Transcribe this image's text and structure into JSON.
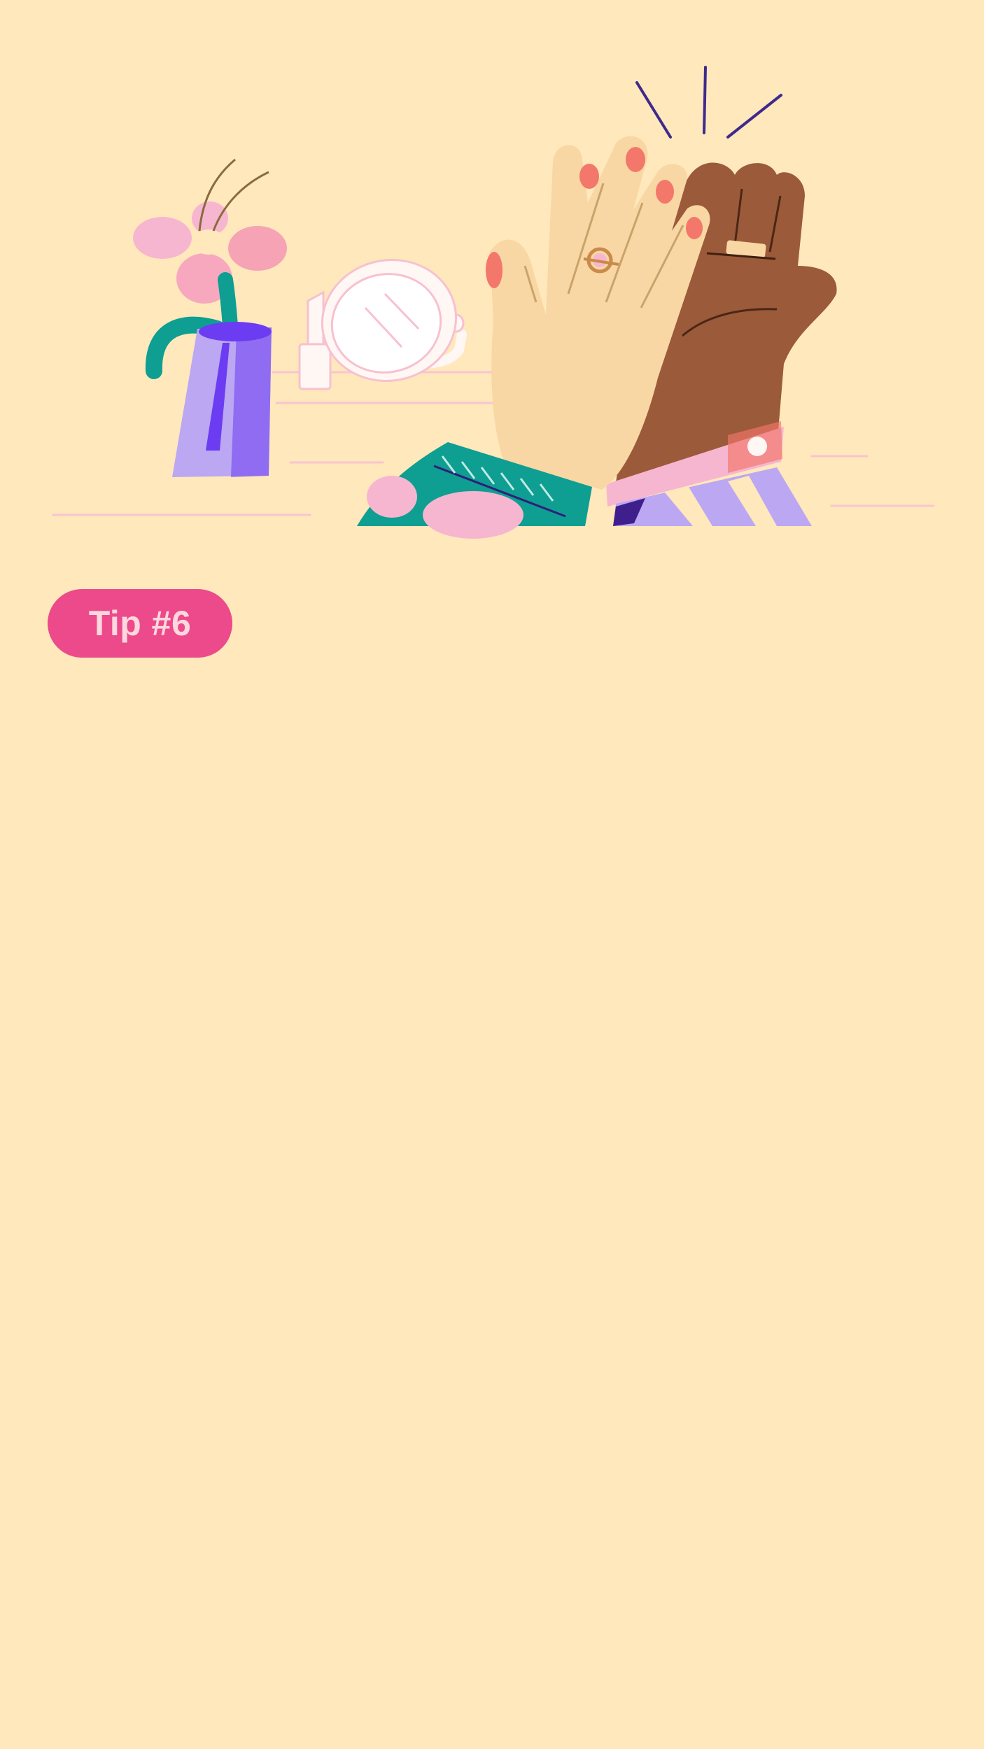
{
  "tip": {
    "label": "Tip #6"
  },
  "illustration": {
    "subject": "high-five-hands-with-vanity-items",
    "icons": [
      "flower-vase-icon",
      "lipstick-icon",
      "hand-mirror-icon",
      "high-five-hands-icon"
    ]
  },
  "colors": {
    "background": "#FFE8BC",
    "badge": "#EC4A8B",
    "badge_text": "#FFD8DE",
    "teal": "#0E9E92",
    "lavender": "#BBA7F2",
    "violet": "#6B3CF2",
    "pink": "#F7B6CF",
    "coral": "#F3776A",
    "light_skin": "#F8D7A4",
    "dark_skin": "#9B5A3A"
  }
}
